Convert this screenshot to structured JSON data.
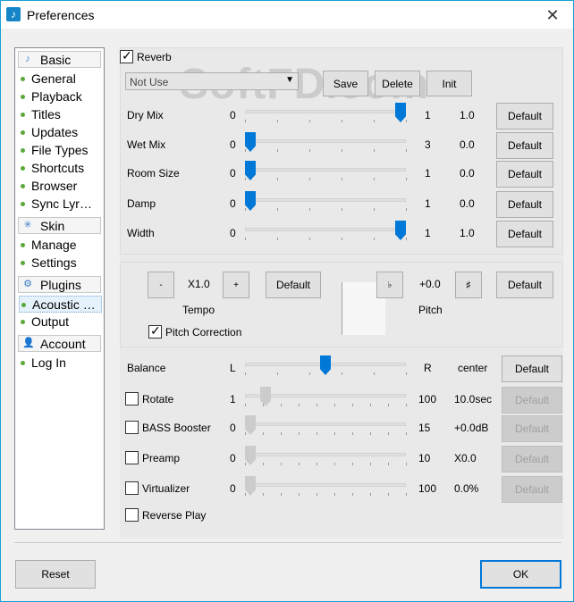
{
  "window": {
    "title": "Preferences",
    "close_glyph": "✕",
    "app_icon_glyph": "♪"
  },
  "sidebar": {
    "groups": [
      {
        "label": "Basic",
        "icon": "music-note-icon",
        "glyph": "♪",
        "items": [
          "General",
          "Playback",
          "Titles",
          "Updates",
          "File Types",
          "Shortcuts",
          "Browser",
          "Sync Lyr…"
        ]
      },
      {
        "label": "Skin",
        "icon": "sparkle-icon",
        "glyph": "✳",
        "items": [
          "Manage",
          "Settings"
        ]
      },
      {
        "label": "Plugins",
        "icon": "gear-icon",
        "glyph": "⚙",
        "items": [
          "Acoustic …",
          "Output"
        ]
      },
      {
        "label": "Account",
        "icon": "user-icon",
        "glyph": "👤",
        "items": [
          "Log In"
        ]
      }
    ],
    "selected_item": "Acoustic …"
  },
  "reverb": {
    "enabled_label": "Reverb",
    "enabled": true,
    "preset": {
      "value": "Not Use"
    },
    "save_label": "Save",
    "delete_label": "Delete",
    "init_label": "Init",
    "sliders": [
      {
        "name": "Dry Mix",
        "min": "0",
        "max": "1",
        "value": "1.0",
        "level": 1.0,
        "default_label": "Default"
      },
      {
        "name": "Wet Mix",
        "min": "0",
        "max": "3",
        "value": "0.0",
        "level": 0.0,
        "default_label": "Default"
      },
      {
        "name": "Room Size",
        "min": "0",
        "max": "1",
        "value": "0.0",
        "level": 0.0,
        "default_label": "Default"
      },
      {
        "name": "Damp",
        "min": "0",
        "max": "1",
        "value": "0.0",
        "level": 0.0,
        "default_label": "Default"
      },
      {
        "name": "Width",
        "min": "0",
        "max": "1",
        "value": "1.0",
        "level": 1.0,
        "default_label": "Default"
      }
    ]
  },
  "tempo_pitch": {
    "tempo_minus": "-",
    "tempo_value": "X1.0",
    "tempo_plus": "+",
    "tempo_default": "Default",
    "tempo_label": "Tempo",
    "pitch_flat": "♭",
    "pitch_value": "+0.0",
    "pitch_sharp": "♯",
    "pitch_default": "Default",
    "pitch_label": "Pitch",
    "pitch_correction_label": "Pitch Correction",
    "pitch_correction": true
  },
  "balance": {
    "label": "Balance",
    "left": "L",
    "right": "R",
    "value": "center",
    "level": 0.5,
    "default_label": "Default"
  },
  "effects": [
    {
      "name": "Rotate",
      "min": "1",
      "max": "100",
      "value": "10.0sec",
      "level": 0.1,
      "checked": false,
      "default_label": "Default"
    },
    {
      "name": "BASS Booster",
      "min": "0",
      "max": "15",
      "value": "+0.0dB",
      "level": 0.0,
      "checked": false,
      "default_label": "Default"
    },
    {
      "name": "Preamp",
      "min": "0",
      "max": "10",
      "value": "X0.0",
      "level": 0.0,
      "checked": false,
      "default_label": "Default"
    },
    {
      "name": "Virtualizer",
      "min": "0",
      "max": "100",
      "value": "0.0%",
      "level": 0.0,
      "checked": false,
      "default_label": "Default"
    }
  ],
  "reverse_play": {
    "label": "Reverse Play",
    "checked": false
  },
  "footer": {
    "reset_label": "Reset",
    "ok_label": "OK"
  },
  "watermark": "SoftFD.com",
  "colors": {
    "accent": "#0078d7",
    "title_border": "#1a9fd6",
    "bullet": "#5aa83a"
  }
}
